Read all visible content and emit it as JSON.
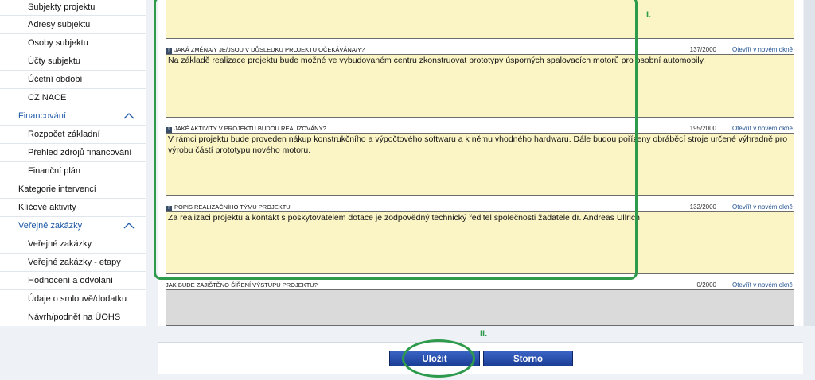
{
  "sidebar": {
    "items": [
      {
        "label": "Subjekty projektu"
      },
      {
        "label": "Adresy subjektu"
      },
      {
        "label": "Osoby subjektu"
      },
      {
        "label": "Účty subjektu"
      },
      {
        "label": "Účetní období"
      },
      {
        "label": "CZ NACE"
      },
      {
        "label": "Financování"
      },
      {
        "label": "Rozpočet základní"
      },
      {
        "label": "Přehled zdrojů financování"
      },
      {
        "label": "Finanční plán"
      },
      {
        "label": "Kategorie intervencí"
      },
      {
        "label": "Klíčové aktivity"
      },
      {
        "label": "Veřejné zakázky"
      },
      {
        "label": "Veřejné zakázky"
      },
      {
        "label": "Veřejné zakázky - etapy"
      },
      {
        "label": "Hodnocení a odvolání"
      },
      {
        "label": "Údaje o smlouvě/dodatku"
      },
      {
        "label": "Návrh/podnět na ÚOHS"
      }
    ]
  },
  "form": {
    "open_link": "Otevřít v novém okně",
    "fields": [
      {
        "label": "",
        "count": "",
        "value": ""
      },
      {
        "num": "!",
        "label": "Jaká změna/y je/jsou v důsledku projektu očekávána/y?",
        "count": "137/2000",
        "value": "Na základě realizace projektu bude možné ve vybudovaném centru zkonstruovat prototypy úsporných spalovacích motorů pro osobní automobily."
      },
      {
        "num": "!",
        "label": "Jaké aktivity v projektu budou realizovány?",
        "count": "195/2000",
        "value": "V rámci projektu bude proveden nákup konstrukčního a výpočtového softwaru a k němu vhodného hardwaru. Dále budou pořízeny obráběcí stroje určené výhradně pro výrobu částí prototypu nového motoru."
      },
      {
        "num": "!",
        "label": "Popis realizačního týmu projektu",
        "count": "132/2000",
        "value": "Za realizaci projektu a kontakt s poskytovatelem dotace je zodpovědný technický ředitel společnosti žadatele dr. Andreas Ullrich."
      },
      {
        "label": "Jak bude zajištěno šíření výstupu projektu?",
        "count": "0/2000",
        "value": ""
      }
    ]
  },
  "markers": {
    "one": "I.",
    "two": "II."
  },
  "buttons": {
    "save": "Uložit",
    "cancel": "Storno"
  },
  "colors": {
    "highlight": "#2e9a4b",
    "field_bg": "#fbf5c6",
    "button": "#1b3e96",
    "link": "#1e4f8f"
  }
}
